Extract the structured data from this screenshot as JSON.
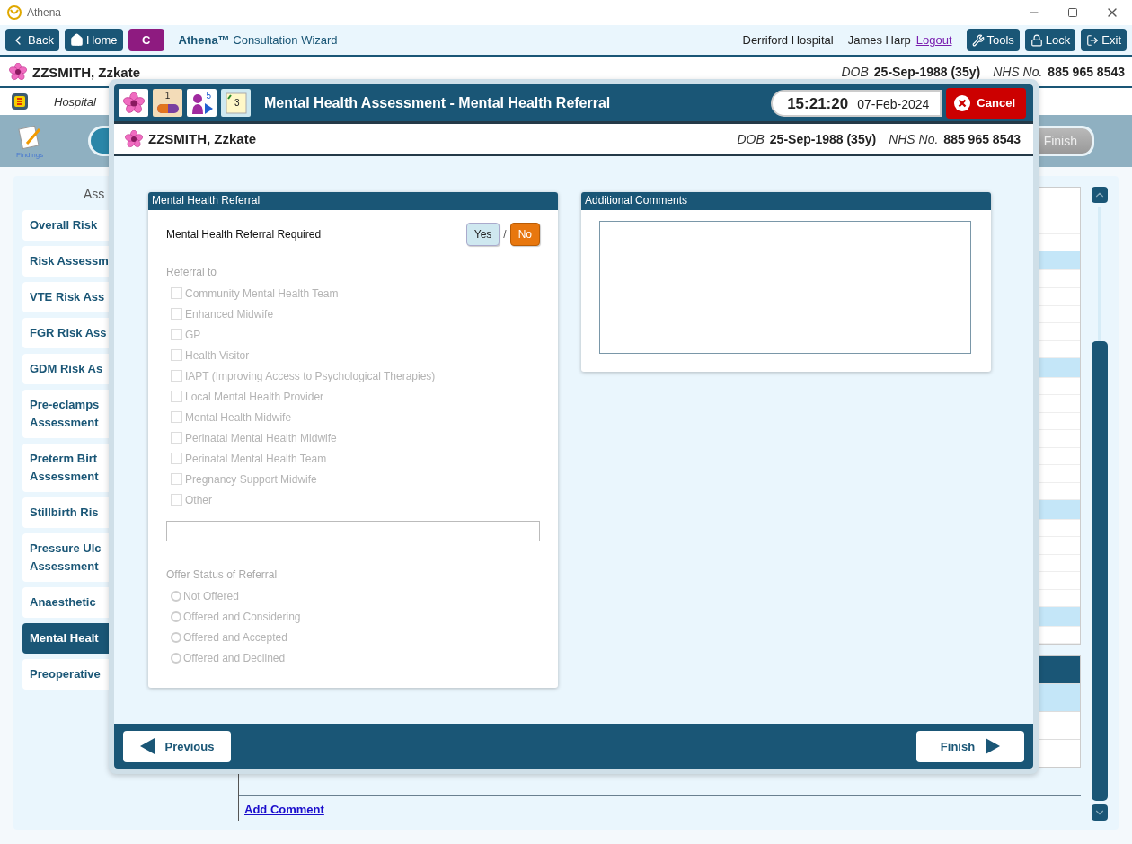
{
  "app": {
    "title": "Athena"
  },
  "top_bar": {
    "back": "Back",
    "home": "Home",
    "c_button": "C",
    "wizard_title": "**Athena™** Consultation Wizard",
    "hospital": "Derriford Hospital",
    "user": "James Harp",
    "logout": "Logout",
    "tools": "Tools",
    "lock": "Lock",
    "exit": "Exit"
  },
  "patient": {
    "name": "ZZSMITH, Zzkate",
    "dob_label": "DOB",
    "dob": "25-Sep-1988 (35y)",
    "nhs_label": "NHS No.",
    "nhs": "885 965 8543"
  },
  "hospital_bar": {
    "text": "Hospital"
  },
  "toolbar": {
    "findings": "Findings",
    "finish": "Finish"
  },
  "nav": {
    "heading": "Ass",
    "items": [
      {
        "label": "Overall Risk",
        "selected": false
      },
      {
        "label": "Risk Assessm",
        "selected": false
      },
      {
        "label": "VTE Risk Ass",
        "selected": false
      },
      {
        "label": "FGR Risk Ass",
        "selected": false
      },
      {
        "label": "GDM Risk As",
        "selected": false
      },
      {
        "label": "Pre-eclamps\nAssessment",
        "selected": false
      },
      {
        "label": "Preterm Birt\nAssessment",
        "selected": false
      },
      {
        "label": "Stillbirth Ris",
        "selected": false
      },
      {
        "label": "Pressure Ulc\nAssessment",
        "selected": false
      },
      {
        "label": "Anaesthetic",
        "selected": false
      },
      {
        "label": "Mental Healt",
        "selected": true
      },
      {
        "label": "Preoperative",
        "selected": false
      }
    ]
  },
  "background_list": {
    "add_comment": "Add Comment"
  },
  "modal": {
    "badges": {
      "meds": "1",
      "people": "5",
      "notes": "3"
    },
    "title": "Mental Health Assessment - Mental Health Referral",
    "time": "15:21:20",
    "date": "07-Feb-2024",
    "cancel": "Cancel",
    "patient": {
      "name": "ZZSMITH, Zzkate",
      "dob_label": "DOB",
      "dob": "25-Sep-1988 (35y)",
      "nhs_label": "NHS No.",
      "nhs": "885 965 8543"
    },
    "referral_panel": {
      "title": "Mental Health Referral",
      "question": "Mental Health Referral Required",
      "separator": "/",
      "options": [
        {
          "label": "Yes",
          "selected": false
        },
        {
          "label": "No",
          "selected": true
        }
      ],
      "disabled": true,
      "referral_label": "Referral to",
      "referrals": [
        {
          "label": "Community Mental Health Team",
          "checked": false
        },
        {
          "label": "Enhanced Midwife",
          "checked": false
        },
        {
          "label": "GP",
          "checked": false
        },
        {
          "label": "Health Visitor",
          "checked": false
        },
        {
          "label": "IAPT (Improving Access to Psychological Therapies)",
          "checked": false
        },
        {
          "label": "Local Mental Health Provider",
          "checked": false
        },
        {
          "label": "Mental Health Midwife",
          "checked": false
        },
        {
          "label": "Perinatal Mental Health Midwife",
          "checked": false
        },
        {
          "label": "Perinatal Mental Health Team",
          "checked": false
        },
        {
          "label": "Pregnancy Support Midwife",
          "checked": false
        },
        {
          "label": "Other",
          "checked": false
        }
      ],
      "offer_label": "Offer Status of Referral",
      "offers": [
        {
          "label": "Not Offered",
          "selected": false
        },
        {
          "label": "Offered and Considering",
          "selected": false
        },
        {
          "label": "Offered and Accepted",
          "selected": false
        },
        {
          "label": "Offered and Declined",
          "selected": false
        }
      ]
    },
    "comments_panel": {
      "title": "Additional Comments"
    },
    "previous": "Previous",
    "finish": "Finish"
  }
}
